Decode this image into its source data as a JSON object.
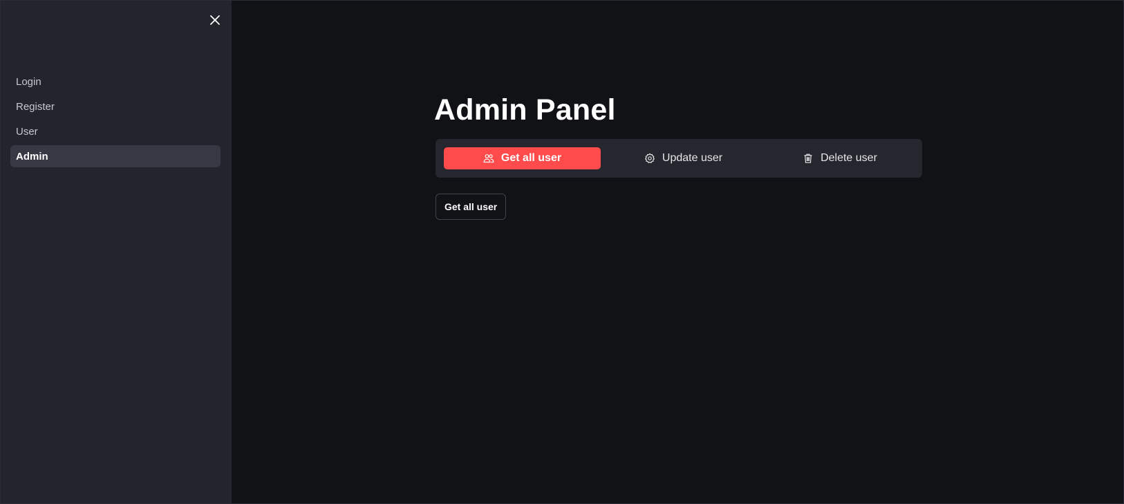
{
  "sidebar": {
    "close_icon": "close-icon",
    "items": [
      {
        "label": "Login"
      },
      {
        "label": "Register"
      },
      {
        "label": "User"
      },
      {
        "label": "Admin"
      }
    ],
    "active_item": "Admin"
  },
  "main": {
    "title": "Admin Panel",
    "tabs": [
      {
        "label": "Get all user",
        "icon": "users-icon"
      },
      {
        "label": "Update user",
        "icon": "gear-icon"
      },
      {
        "label": "Delete user",
        "icon": "trash-icon"
      }
    ],
    "active_tab": "Get all user",
    "action_button": "Get all user"
  },
  "colors": {
    "accent": "#ff4b4b",
    "sidebar_bg": "#23242c",
    "main_bg": "#111216",
    "tabs_bg": "#25262e",
    "active_nav_bg": "#373844"
  }
}
